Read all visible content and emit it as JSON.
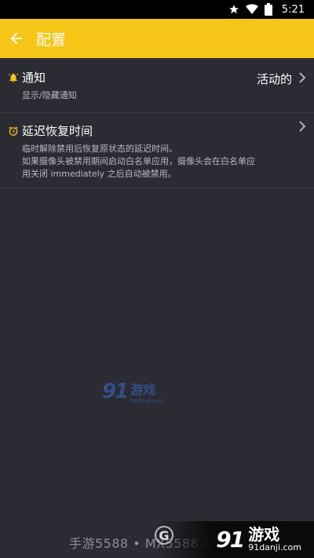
{
  "statusbar": {
    "time": "5:21",
    "icons": [
      "star-icon",
      "wifi-icon",
      "battery-icon"
    ]
  },
  "appbar": {
    "title": "配置",
    "back_icon": "back-arrow-icon",
    "color": "#f5c518"
  },
  "settings": {
    "notifications": {
      "icon": "bell-icon",
      "title": "通知",
      "subtitle": "显示/隐藏通知",
      "value": "活动的"
    },
    "delay_restore": {
      "icon": "alarm-clock-icon",
      "title": "延迟恢复时间",
      "description_line1": "临时解除禁用后恢复原状态的延迟时间。",
      "description_line2": "如果摄像头被禁用期间启动白名单应用，摄像头会在白名单应",
      "description_line3": "用关闭 immediately 之后自动被禁用。"
    }
  },
  "watermarks": {
    "center_logo": "91",
    "center_name": "游戏",
    "center_url": "91danji.com",
    "bottom_left": "手游5588 • MX5588.COM",
    "bottom_g": "G",
    "bottom_logo": "91",
    "bottom_name": "游戏",
    "bottom_url": "91danji.com"
  },
  "colors": {
    "background": "#2b2b33",
    "accent": "#f5c518",
    "icon_yellow": "#f5c518"
  }
}
